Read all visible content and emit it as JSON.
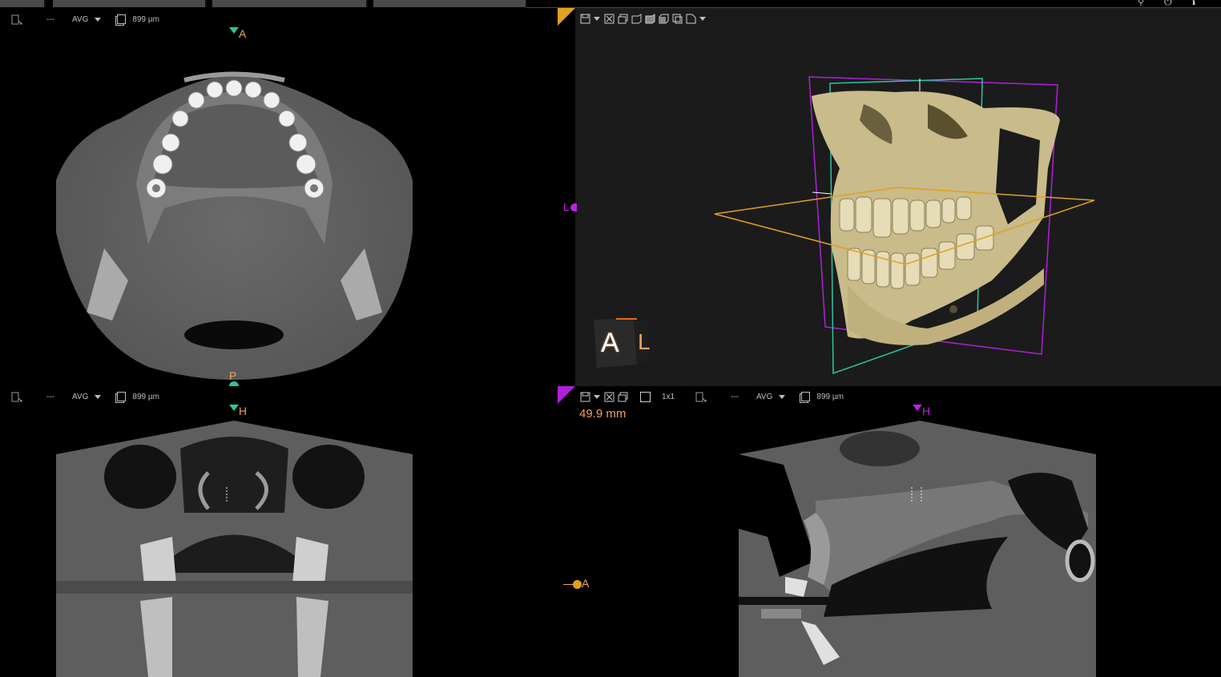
{
  "viewports": {
    "axial": {
      "mode_dash": "---",
      "mode": "AVG",
      "thickness": "899 µm",
      "orient_top": "A",
      "orient_bottom": "P"
    },
    "coronal": {
      "mode_dash": "---",
      "mode": "AVG",
      "thickness": "899 µm",
      "orient_top": "H"
    },
    "sagittal": {
      "mode_dash": "---",
      "mode": "AVG",
      "thickness": "899 µm",
      "orient_top": "H",
      "orient_left": "A",
      "measurement": "49.9 mm"
    },
    "volume3d": {
      "orient_left": "L",
      "cube_front": "A",
      "cube_side": "L"
    }
  },
  "bottom_toolbar": {
    "layout_label": "1x1"
  },
  "colors": {
    "axial_accent": "#e0a020",
    "coronal_accent": "#2ec4a0",
    "sagittal_accent": "#c020e0",
    "orient_orange": "#f2a35b"
  },
  "icons": [
    "layout-icon",
    "dropdown-caret-icon",
    "copy-icon",
    "save-icon",
    "fit-icon",
    "screenshot-icon",
    "view-cube-icon",
    "window-icon",
    "user-icon",
    "power-icon",
    "info-icon"
  ]
}
